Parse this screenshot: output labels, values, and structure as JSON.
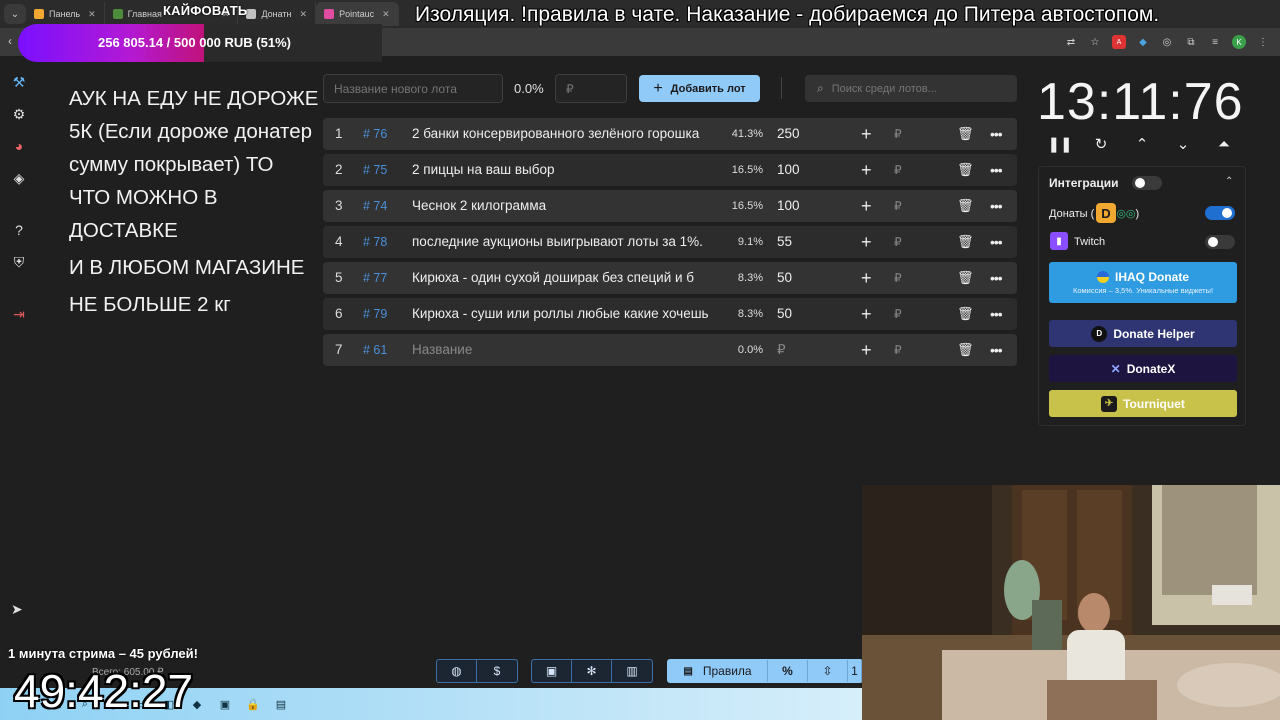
{
  "browser": {
    "tabs": [
      {
        "label": "Панель",
        "color": "#f0a830"
      },
      {
        "label": "Главная",
        "color": "#4c8c3a"
      },
      {
        "label": "Донатн",
        "color": "#c0c0c0"
      },
      {
        "label": "Pointauc",
        "color": "#e04ca0"
      }
    ]
  },
  "overlay": {
    "kaif": "КАЙФОВАТЬ",
    "ticker": "Изоляция. !правила в чате. Наказание - добираемся до Питера автостопом.",
    "goal_text": "256 805.14 / 500 000 RUB (51%)",
    "goal_fraction": 0.51,
    "minute_text": "1 минута стрима – 45 рублей!",
    "big_clock": "49:42:27",
    "vsego": "Всего: 605.00 ₽"
  },
  "rules_text": [
    "АУК НА ЕДУ НЕ ДОРОЖЕ 5К (Если дороже донатер сумму покрывает) ТО ЧТО МОЖНО В ДОСТАВКЕ",
    "И В ЛЮБОМ МАГАЗИНЕ",
    "НЕ БОЛЬШЕ 2 кг"
  ],
  "toolbar": {
    "new_lot_placeholder": "Название нового лота",
    "percent": "0.0%",
    "amount_placeholder": "₽",
    "add_label": "Добавить лот",
    "search_placeholder": "Поиск среди лотов..."
  },
  "lots": [
    {
      "n": "1",
      "id": "# 76",
      "name": "2 банки консервированного зелёного горошка",
      "pct": "41.3%",
      "amt": "250"
    },
    {
      "n": "2",
      "id": "# 75",
      "name": "2 пиццы на ваш выбор",
      "pct": "16.5%",
      "amt": "100"
    },
    {
      "n": "3",
      "id": "# 74",
      "name": "Чеснок 2 килограмма",
      "pct": "16.5%",
      "amt": "100"
    },
    {
      "n": "4",
      "id": "# 78",
      "name": "последние аукционы выигрывают лоты за 1%.",
      "pct": "9.1%",
      "amt": "55"
    },
    {
      "n": "5",
      "id": "# 77",
      "name": "Кирюха - один сухой доширак без специй и б",
      "pct": "8.3%",
      "amt": "50"
    },
    {
      "n": "6",
      "id": "# 79",
      "name": "Кирюха - суши или роллы любые какие хочешь",
      "pct": "8.3%",
      "amt": "50"
    },
    {
      "n": "7",
      "id": "# 61",
      "name": "Название",
      "pct": "0.0%",
      "amt": "₽",
      "placeholder": true
    }
  ],
  "timer": "13:11:76",
  "integrations": {
    "title": "Интеграции",
    "donations_label": "Донаты (",
    "donations_suffix": ")",
    "twitch_label": "Twitch",
    "ihaq_label": "IHAQ Donate",
    "ihaq_sub": "Комиссия – 3,5%. Уникальные виджеты!",
    "donate_helper": "Donate Helper",
    "donatex": "DonateX",
    "tourniquet": "Tourniquet",
    "colors": {
      "ihaq": "#2f9be0",
      "helper": "#2f3572",
      "donatex": "#1d1440",
      "tourniquet": "#c9c24a"
    }
  },
  "bottom_toolbar": {
    "rules_label": "Правила"
  }
}
